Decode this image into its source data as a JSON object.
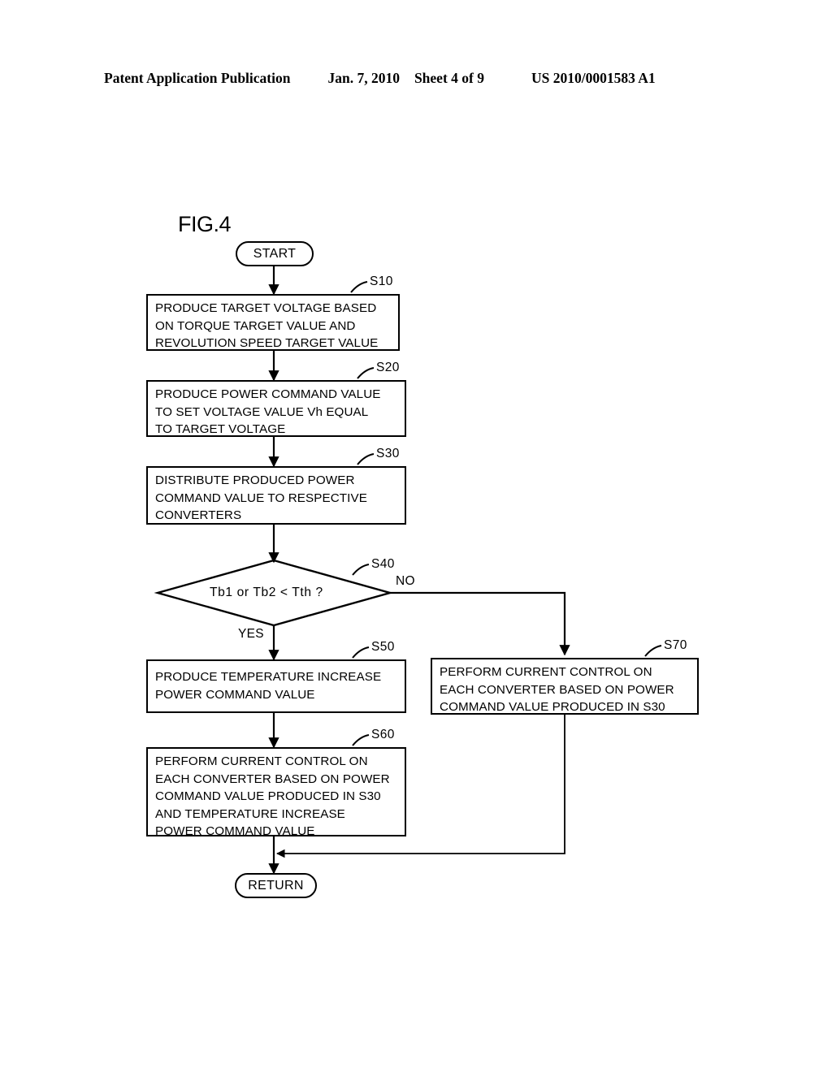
{
  "header": {
    "publication": "Patent Application Publication",
    "date": "Jan. 7, 2010",
    "sheet": "Sheet 4 of 9",
    "patent_number": "US 2010/0001583 A1"
  },
  "figure": {
    "label": "FIG.4",
    "start_label": "START",
    "return_label": "RETURN",
    "decision_text": "Tb1 or Tb2 < Tth ?",
    "yes_label": "YES",
    "no_label": "NO",
    "steps": [
      {
        "tag": "S10",
        "text": "PRODUCE TARGET VOLTAGE BASED\nON TORQUE TARGET VALUE AND\nREVOLUTION SPEED TARGET VALUE"
      },
      {
        "tag": "S20",
        "text": "PRODUCE POWER COMMAND VALUE\nTO SET VOLTAGE VALUE Vh EQUAL\nTO TARGET VOLTAGE"
      },
      {
        "tag": "S30",
        "text": "DISTRIBUTE PRODUCED POWER\nCOMMAND VALUE TO RESPECTIVE\nCONVERTERS"
      },
      {
        "tag": "S40",
        "text": "Tb1 or Tb2 < Tth ?"
      },
      {
        "tag": "S50",
        "text": "PRODUCE TEMPERATURE INCREASE\nPOWER COMMAND VALUE"
      },
      {
        "tag": "S60",
        "text": "PERFORM CURRENT CONTROL ON\nEACH CONVERTER BASED ON POWER\nCOMMAND VALUE PRODUCED IN S30\nAND TEMPERATURE INCREASE\nPOWER COMMAND VALUE"
      },
      {
        "tag": "S70",
        "text": "PERFORM CURRENT CONTROL ON\nEACH CONVERTER BASED ON POWER\nCOMMAND VALUE PRODUCED IN S30"
      }
    ]
  }
}
